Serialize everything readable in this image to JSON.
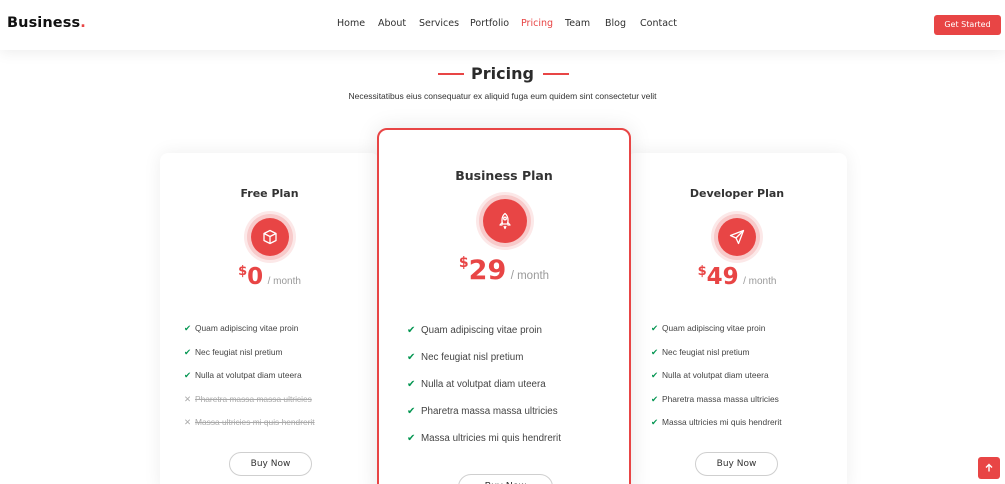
{
  "brand": {
    "name": "Business",
    "dot": "."
  },
  "nav": {
    "items": [
      "Home",
      "About",
      "Services",
      "Portfolio",
      "Pricing",
      "Team",
      "Blog",
      "Contact"
    ],
    "active": "Pricing",
    "cta_label": "Get Started"
  },
  "section": {
    "title": "Pricing",
    "subtitle": "Necessitatibus eius consequatur ex aliquid fuga eum quidem sint consectetur velit"
  },
  "plans": [
    {
      "name": "Free Plan",
      "icon": "box-icon",
      "currency": "$",
      "amount": "0",
      "period": "/ month",
      "features": [
        {
          "text": "Quam adipiscing vitae proin",
          "included": true
        },
        {
          "text": "Nec feugiat nisl pretium",
          "included": true
        },
        {
          "text": "Nulla at volutpat diam uteera",
          "included": true
        },
        {
          "text": "Pharetra massa massa ultricies",
          "included": false
        },
        {
          "text": "Massa ultricies mi quis hendrerit",
          "included": false
        }
      ],
      "button": "Buy Now"
    },
    {
      "name": "Business Plan",
      "icon": "rocket-icon",
      "currency": "$",
      "amount": "29",
      "period": "/ month",
      "features": [
        {
          "text": "Quam adipiscing vitae proin",
          "included": true
        },
        {
          "text": "Nec feugiat nisl pretium",
          "included": true
        },
        {
          "text": "Nulla at volutpat diam uteera",
          "included": true
        },
        {
          "text": "Pharetra massa massa ultricies",
          "included": true
        },
        {
          "text": "Massa ultricies mi quis hendrerit",
          "included": true
        }
      ],
      "button": "Buy Now"
    },
    {
      "name": "Developer Plan",
      "icon": "send-icon",
      "currency": "$",
      "amount": "49",
      "period": "/ month",
      "features": [
        {
          "text": "Quam adipiscing vitae proin",
          "included": true
        },
        {
          "text": "Nec feugiat nisl pretium",
          "included": true
        },
        {
          "text": "Nulla at volutpat diam uteera",
          "included": true
        },
        {
          "text": "Pharetra massa massa ultricies",
          "included": true
        },
        {
          "text": "Massa ultricies mi quis hendrerit",
          "included": true
        }
      ],
      "button": "Buy Now"
    }
  ],
  "colors": {
    "accent": "#e84545",
    "check": "#059652",
    "muted": "#aaaaaa"
  },
  "back_to_top": {
    "icon": "arrow-up-icon"
  }
}
